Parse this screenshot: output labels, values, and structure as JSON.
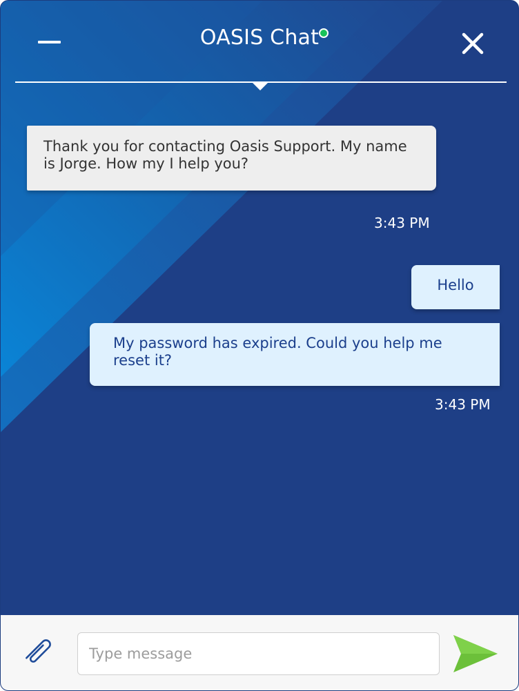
{
  "header": {
    "title": "OASIS Chat",
    "status_color": "#19c25a"
  },
  "messages": [
    {
      "sender": "agent",
      "text": "Thank you for contacting Oasis Support. My name is Jorge. How my I help you?"
    },
    {
      "sender": "user",
      "text": "Hello"
    },
    {
      "sender": "user",
      "text": "My password has expired. Could you help me reset it?"
    }
  ],
  "timestamps": [
    "3:43 PM",
    "3:43 PM"
  ],
  "composer": {
    "placeholder": "Type message",
    "value": ""
  },
  "icons": {
    "minimize": "minimize-icon",
    "close": "close-icon",
    "attach": "paperclip-icon",
    "send": "send-icon"
  },
  "colors": {
    "header_bg": "#1e3f86",
    "accent_light_blue": "#0a7fd1",
    "agent_bubble": "#eeeeee",
    "user_bubble": "#dff1fe",
    "user_text": "#1b3f8c",
    "send_green": "#6cc03a"
  }
}
